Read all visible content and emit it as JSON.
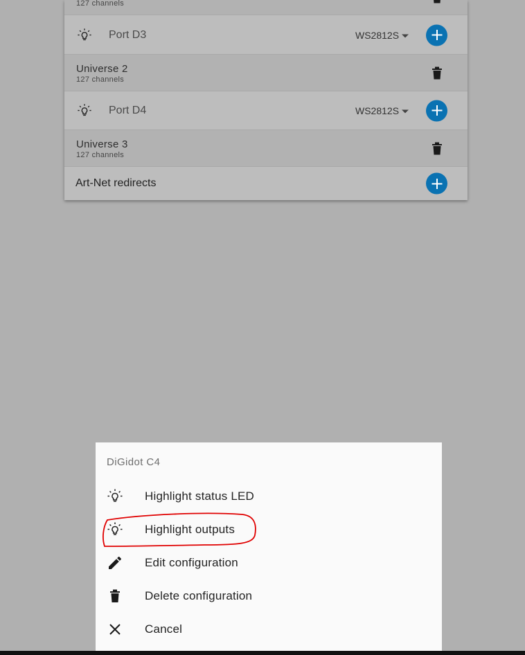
{
  "card": {
    "top_universe": {
      "sub": "127 channels"
    },
    "rows": [
      {
        "port": "Port D3",
        "led": "WS2812S"
      },
      {
        "title": "Universe 2",
        "sub": "127 channels"
      },
      {
        "port": "Port D4",
        "led": "WS2812S"
      },
      {
        "title": "Universe 3",
        "sub": "127 channels"
      }
    ],
    "redirects_label": "Art-Net redirects"
  },
  "sheet": {
    "title": "DiGidot C4",
    "items": [
      {
        "label": "Highlight status LED",
        "icon": "lightbulb-icon"
      },
      {
        "label": "Highlight outputs",
        "icon": "lightbulb-icon",
        "annotated": true
      },
      {
        "label": "Edit configuration",
        "icon": "pencil-icon"
      },
      {
        "label": "Delete configuration",
        "icon": "trash-icon"
      },
      {
        "label": "Cancel",
        "icon": "close-icon"
      }
    ]
  },
  "colors": {
    "accent": "#0a72b2",
    "annotation": "#e00000"
  }
}
